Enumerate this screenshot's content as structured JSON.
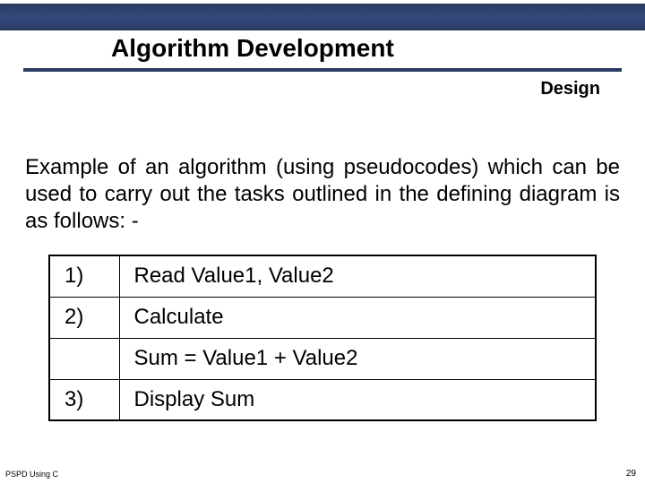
{
  "header": {
    "title": "Algorithm Development",
    "subtitle": "Design"
  },
  "body": {
    "paragraph": "Example of an algorithm (using pseudocodes) which can be used to carry out the tasks outlined in the defining diagram is as follows: -"
  },
  "steps": [
    {
      "num": "1)",
      "text": "Read Value1, Value2"
    },
    {
      "num": "2)",
      "text": "Calculate"
    },
    {
      "num": "",
      "text": "Sum = Value1 + Value2"
    },
    {
      "num": "3)",
      "text": "Display Sum"
    }
  ],
  "footer": {
    "left": "PSPD Using C",
    "page": "29"
  }
}
